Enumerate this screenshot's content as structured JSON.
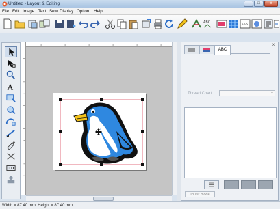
{
  "window": {
    "title": "Untitled - Layout & Editing",
    "minimize": "–",
    "maximize": "□",
    "close": "x"
  },
  "menu": [
    "File",
    "Edit",
    "Image",
    "Text",
    "Sew",
    "Display",
    "Option",
    "Help"
  ],
  "toolbar": {
    "icons": [
      "new-file-icon",
      "open-folder-icon",
      "scan-icon",
      "import-icon",
      "save-icon",
      "save-as-icon",
      "undo-icon",
      "redo-icon",
      "cut-icon",
      "copy-icon",
      "paste-icon",
      "send-icon",
      "print-icon",
      "rotate-icon",
      "pencil-icon",
      "sewing-attributes-icon",
      "abc-text-icon",
      "color-icon",
      "grid-icon",
      "design-center-icon",
      "wizard-icon",
      "properties-icon",
      "refresh-icon"
    ]
  },
  "palette": {
    "tools": [
      "select-arrow-icon",
      "point-edit-icon",
      "zoom-icon",
      "text-icon",
      "shape-icon",
      "circle-icon",
      "arc-icon",
      "line-icon",
      "brush-icon",
      "stamp-icon",
      "manual-punch-icon",
      "import-sample-icon"
    ]
  },
  "panel": {
    "tabs": [
      "",
      "",
      "ABC"
    ],
    "thread_chart_label": "Thread Chart",
    "thread_chart_value": "",
    "to_list_mode": "To list mode",
    "close": "x"
  },
  "status": {
    "text": "Width = 87.40 mm, Height = 87.40 mm"
  },
  "colors": {
    "accent": "#3a7bd5",
    "penguin_blue": "#2f88e0",
    "penguin_black": "#111111",
    "beak": "#f2c21b",
    "selection": "#d7364a"
  }
}
